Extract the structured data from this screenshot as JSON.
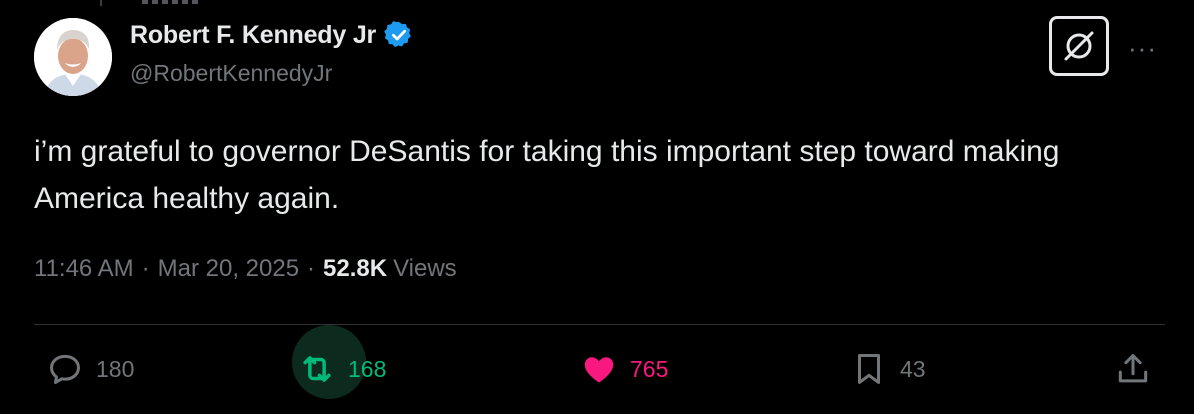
{
  "author": {
    "name": "Robert F. Kennedy Jr",
    "handle": "@RobertKennedyJr",
    "verified_color": "#1d9bf0"
  },
  "tweet": {
    "text": "i’m grateful to governor DeSantis for taking this important step toward making America healthy again."
  },
  "meta": {
    "time": "11:46 AM",
    "separator": "·",
    "date": "Mar 20, 2025",
    "views_count": "52.8K",
    "views_label": "Views"
  },
  "actions": {
    "replies": "180",
    "retweets": "168",
    "likes": "765",
    "bookmarks": "43"
  },
  "colors": {
    "background": "#000000",
    "text": "#e7e9ea",
    "muted": "#71767b",
    "retweet": "#00ba7c",
    "like": "#f91880"
  },
  "icons": [
    "grok-icon",
    "more-icon",
    "reply-icon",
    "retweet-icon",
    "heart-icon",
    "bookmark-icon",
    "share-icon",
    "verified-badge-icon"
  ]
}
